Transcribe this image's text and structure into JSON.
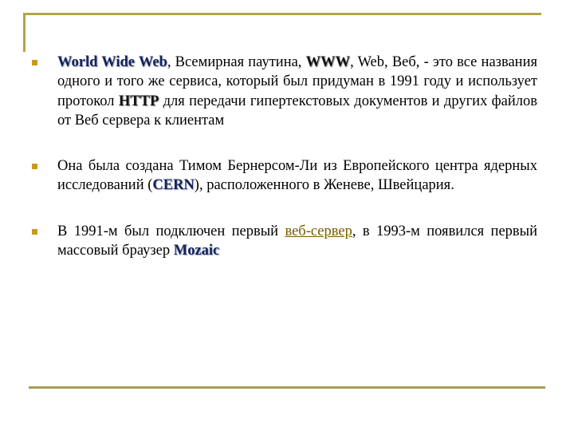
{
  "colors": {
    "rule": "#b3a44a",
    "bullet": "#c99a1a",
    "keyword": "#13235a",
    "link": "#7a5a00"
  },
  "bullets": [
    {
      "kw1": "World Wide Web",
      "t1": ", Всемирная паутина, ",
      "kw2": "WWW",
      "t2": ", Web, Веб, - это все названия одного и того же сервиса, который был придуман в 1991 году и использует протокол ",
      "kw3": "HTTP",
      "t3": " для передачи гипертекстовых документов и других файлов от Веб сервера к клиентам"
    },
    {
      "t1": "Она была создана Тимом Бернерсом-Ли из Европейского центра ядерных исследований (",
      "kw1": "CERN",
      "t2": "), расположенного в Женеве, Швейцария."
    },
    {
      "t1": "В 1991-м был подключен первый ",
      "link": "веб-сервер",
      "t2": ", в 1993-м появился первый массовый браузер ",
      "kw1": "Mozaic"
    }
  ]
}
